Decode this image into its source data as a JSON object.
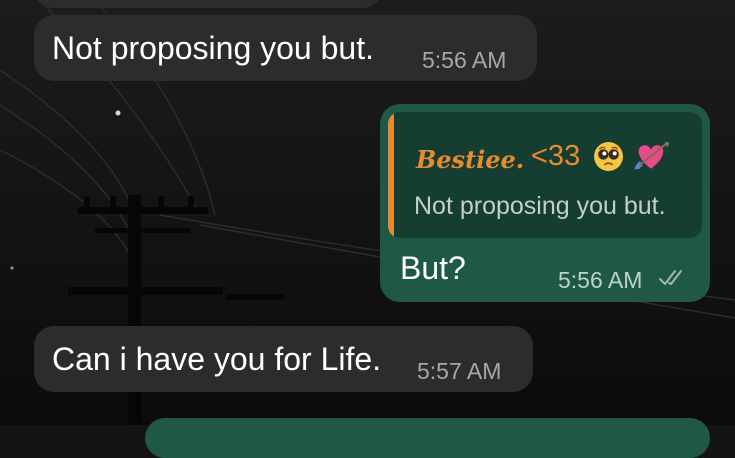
{
  "messages": [
    {
      "type": "incoming",
      "text": "Not proposing you but.",
      "time": "5:56 AM"
    },
    {
      "type": "outgoing",
      "reply_to": {
        "author_name": "Bestiee.",
        "author_suffix": "<33",
        "author_emojis": [
          "pleading-face-emoji",
          "heart-with-arrow-emoji"
        ],
        "text": "Not proposing you but."
      },
      "text": "But?",
      "time": "5:56 AM",
      "status": "read-double-check"
    },
    {
      "type": "incoming",
      "text": "Can i have you for Life.",
      "time": "5:57 AM"
    }
  ],
  "colors": {
    "incoming_bubble": "#2c2c2e",
    "outgoing_bubble": "#1f5945",
    "quote_background": "#163d31",
    "quote_accent": "#e88a2e",
    "read_check": "#9fb9ae"
  }
}
